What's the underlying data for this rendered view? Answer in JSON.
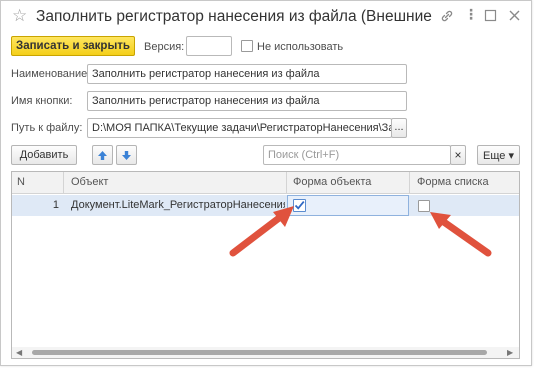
{
  "window": {
    "title": "Заполнить регистратор нанесения из файла (Внешние ...",
    "star_icon": "star-icon",
    "link_icon": "link-icon",
    "more_icon": "more-icon",
    "maximize_icon": "maximize-icon",
    "close_icon": "close-icon"
  },
  "toolbar": {
    "save_close_label": "Записать и закрыть",
    "version_label": "Версия:",
    "version_value": "",
    "not_use_label": "Не использовать",
    "not_use_checked": false
  },
  "form": {
    "name_label": "Наименование:",
    "name_value": "Заполнить регистратор нанесения из файла",
    "button_name_label": "Имя кнопки:",
    "button_name_value": "Заполнить регистратор нанесения из файла",
    "file_path_label": "Путь к файлу:",
    "file_path_value": "D:\\МОЯ ПАПКА\\Текущие задачи\\РегистраторНанесения\\Заполн",
    "file_path_button": "..."
  },
  "table_toolbar": {
    "add_label": "Добавить",
    "up_icon": "arrow-up-icon",
    "down_icon": "arrow-down-icon",
    "search_placeholder": "Поиск (Ctrl+F)",
    "search_clear": "×",
    "more_label": "Еще ▾"
  },
  "table": {
    "columns": [
      "N",
      "Объект",
      "Форма объекта",
      "Форма списка"
    ],
    "rows": [
      {
        "n": "1",
        "object": "Документ.LiteMark_РегистраторНанесения",
        "object_form": true,
        "list_form": false
      }
    ]
  },
  "colors": {
    "primary_button": "#f4cf19",
    "selected_row": "#dfe9f6",
    "annotation_arrow": "#e0523d",
    "move_arrows": "#3b82d6"
  }
}
